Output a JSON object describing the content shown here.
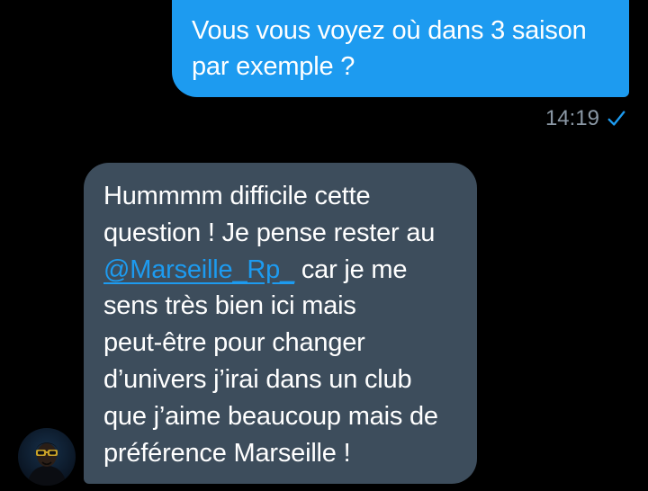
{
  "conversation": {
    "outgoing_message": {
      "lines": [
        "Vous vous voyez où dans 3 saison",
        "par exemple ?"
      ],
      "time": "14:19",
      "status_icon": "checkmark-icon",
      "bubble_color": "#1d9bf0"
    },
    "incoming_message": {
      "line1": "Hummmm difficile cette",
      "line2": "question ! Je pense rester au",
      "mention": "@Marseille_Rp_",
      "line3_rest": " car je me",
      "line4": "sens très bien ici mais",
      "line5": "peut-être pour changer",
      "line6": "d’univers j’irai dans un club",
      "line7": "que j’aime beaucoup mais de",
      "line8": "préférence Marseille !",
      "bubble_color": "#3d4d5c",
      "mention_color": "#1d9bf0"
    },
    "sender_avatar_icon": "avatar-icon"
  }
}
